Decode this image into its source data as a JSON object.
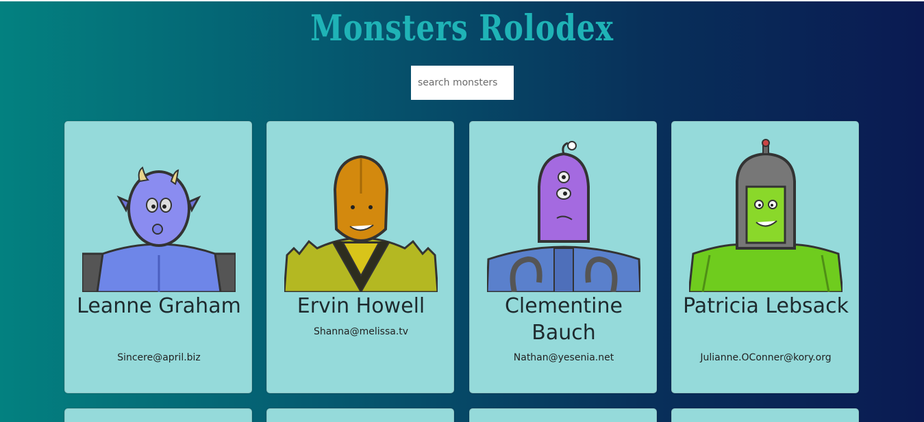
{
  "app": {
    "title": "Monsters Rolodex"
  },
  "search": {
    "placeholder": "search monsters",
    "value": ""
  },
  "monsters": [
    {
      "name": "Leanne Graham",
      "email": "Sincere@april.biz",
      "color": "#7a84f2"
    },
    {
      "name": "Ervin Howell",
      "email": "Shanna@melissa.tv",
      "color": "#d3890e"
    },
    {
      "name": "Clementine Bauch",
      "email": "Nathan@yesenia.net",
      "color": "#a46ae0"
    },
    {
      "name": "Patricia Lebsack",
      "email": "Julianne.OConner@kory.org",
      "color": "#6fcc1e"
    }
  ],
  "colors": {
    "title": "#1fb3b6",
    "card": "#95dada",
    "gradient_start": "#038180",
    "gradient_end": "#0a1a52"
  }
}
